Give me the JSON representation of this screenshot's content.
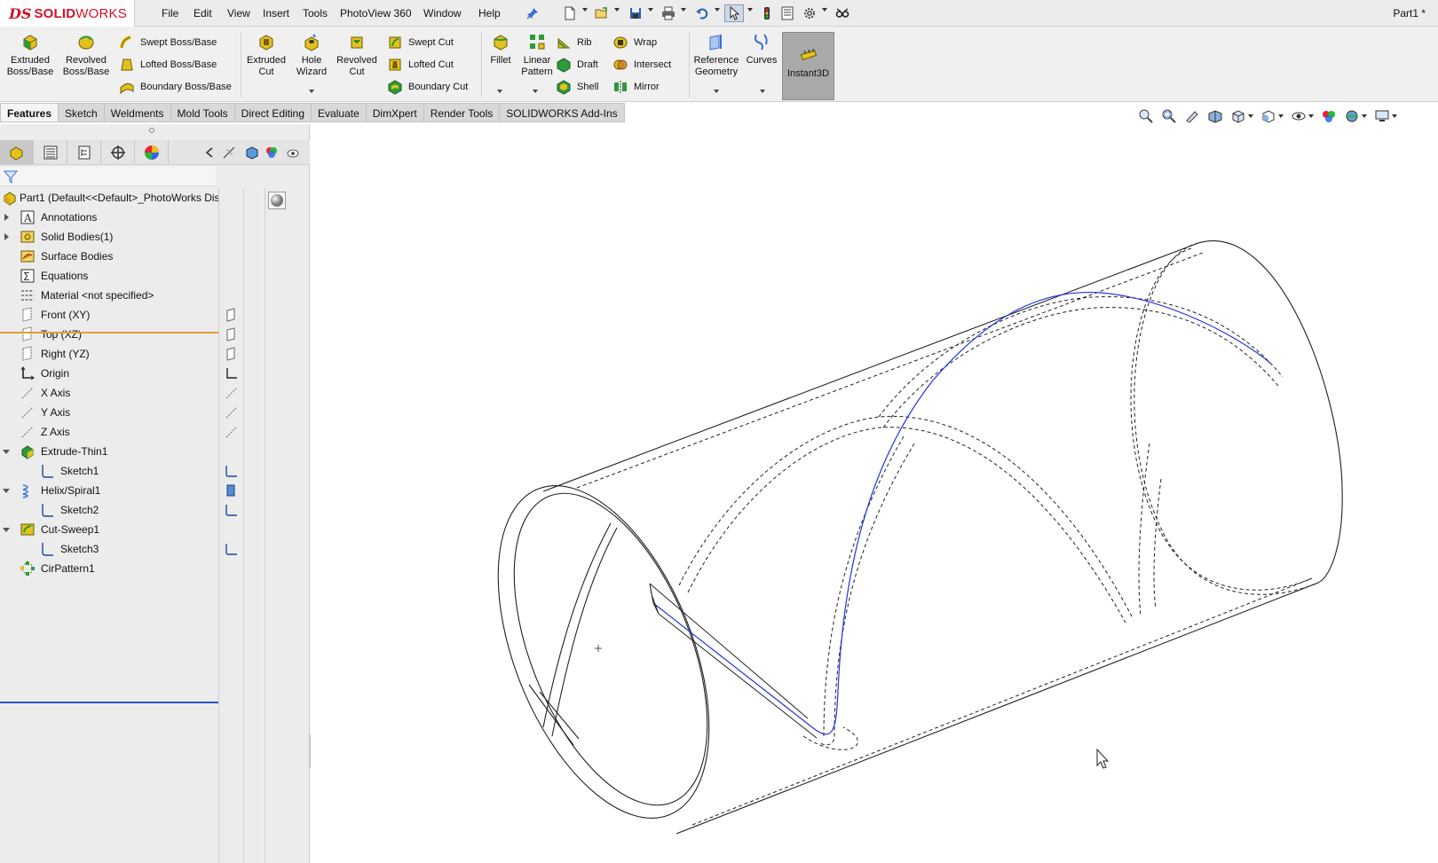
{
  "app": {
    "brand_ds": "DS",
    "brand_name_bold": "SOLID",
    "brand_name_rest": "WORKS",
    "document_title": "Part1 *"
  },
  "menu": {
    "items": [
      {
        "label": "File"
      },
      {
        "label": "Edit"
      },
      {
        "label": "View"
      },
      {
        "label": "Insert"
      },
      {
        "label": "Tools"
      },
      {
        "label": "PhotoView 360"
      },
      {
        "label": "Window"
      },
      {
        "label": "Help"
      }
    ]
  },
  "quick_access": {
    "icons": [
      "pin-icon",
      "new-document-icon",
      "open-icon",
      "save-icon",
      "print-icon",
      "undo-icon",
      "select-icon",
      "rebuild-icon",
      "file-properties-icon",
      "options-icon",
      "customize-icon"
    ]
  },
  "ribbon": {
    "extruded_boss": "Extruded\nBoss/Base",
    "revolved_boss": "Revolved\nBoss/Base",
    "swept_boss": "Swept Boss/Base",
    "lofted_boss": "Lofted Boss/Base",
    "boundary_boss": "Boundary Boss/Base",
    "extruded_cut": "Extruded\nCut",
    "hole_wizard": "Hole\nWizard",
    "revolved_cut": "Revolved\nCut",
    "swept_cut": "Swept Cut",
    "lofted_cut": "Lofted Cut",
    "boundary_cut": "Boundary Cut",
    "fillet": "Fillet",
    "linear_pattern": "Linear\nPattern",
    "rib": "Rib",
    "draft": "Draft",
    "shell": "Shell",
    "wrap": "Wrap",
    "intersect": "Intersect",
    "mirror": "Mirror",
    "reference_geometry": "Reference\nGeometry",
    "curves": "Curves",
    "instant3d": "Instant3D"
  },
  "tabs": [
    {
      "label": "Features",
      "active": true
    },
    {
      "label": "Sketch"
    },
    {
      "label": "Weldments"
    },
    {
      "label": "Mold Tools"
    },
    {
      "label": "Direct Editing"
    },
    {
      "label": "Evaluate"
    },
    {
      "label": "DimXpert"
    },
    {
      "label": "Render Tools"
    },
    {
      "label": "SOLIDWORKS Add-Ins"
    }
  ],
  "feature_tree": {
    "root": "Part1  (Default<<Default>_PhotoWorks Dis",
    "nodes": [
      {
        "label": "Annotations",
        "expander": "closed"
      },
      {
        "label": "Solid Bodies(1)",
        "expander": "closed"
      },
      {
        "label": "Surface Bodies"
      },
      {
        "label": "Equations"
      },
      {
        "label": "Material <not specified>"
      },
      {
        "label": "Front (XY)"
      },
      {
        "label": "Top (XZ)"
      },
      {
        "label": "Right (YZ)"
      },
      {
        "label": "Origin"
      },
      {
        "label": "X Axis"
      },
      {
        "label": "Y Axis"
      },
      {
        "label": "Z Axis"
      },
      {
        "label": "Extrude-Thin1",
        "expander": "open"
      },
      {
        "label": "Sketch1"
      },
      {
        "label": "Helix/Spiral1",
        "expander": "open"
      },
      {
        "label": "Sketch2"
      },
      {
        "label": "Cut-Sweep1",
        "expander": "open"
      },
      {
        "label": "Sketch3"
      },
      {
        "label": "CirPattern1"
      }
    ]
  },
  "colors": {
    "accent_blue": "#2b54c8",
    "helix_blue": "#2233dd",
    "brand_red": "#d0112b",
    "instant3d_active": "#a9a9a9"
  }
}
